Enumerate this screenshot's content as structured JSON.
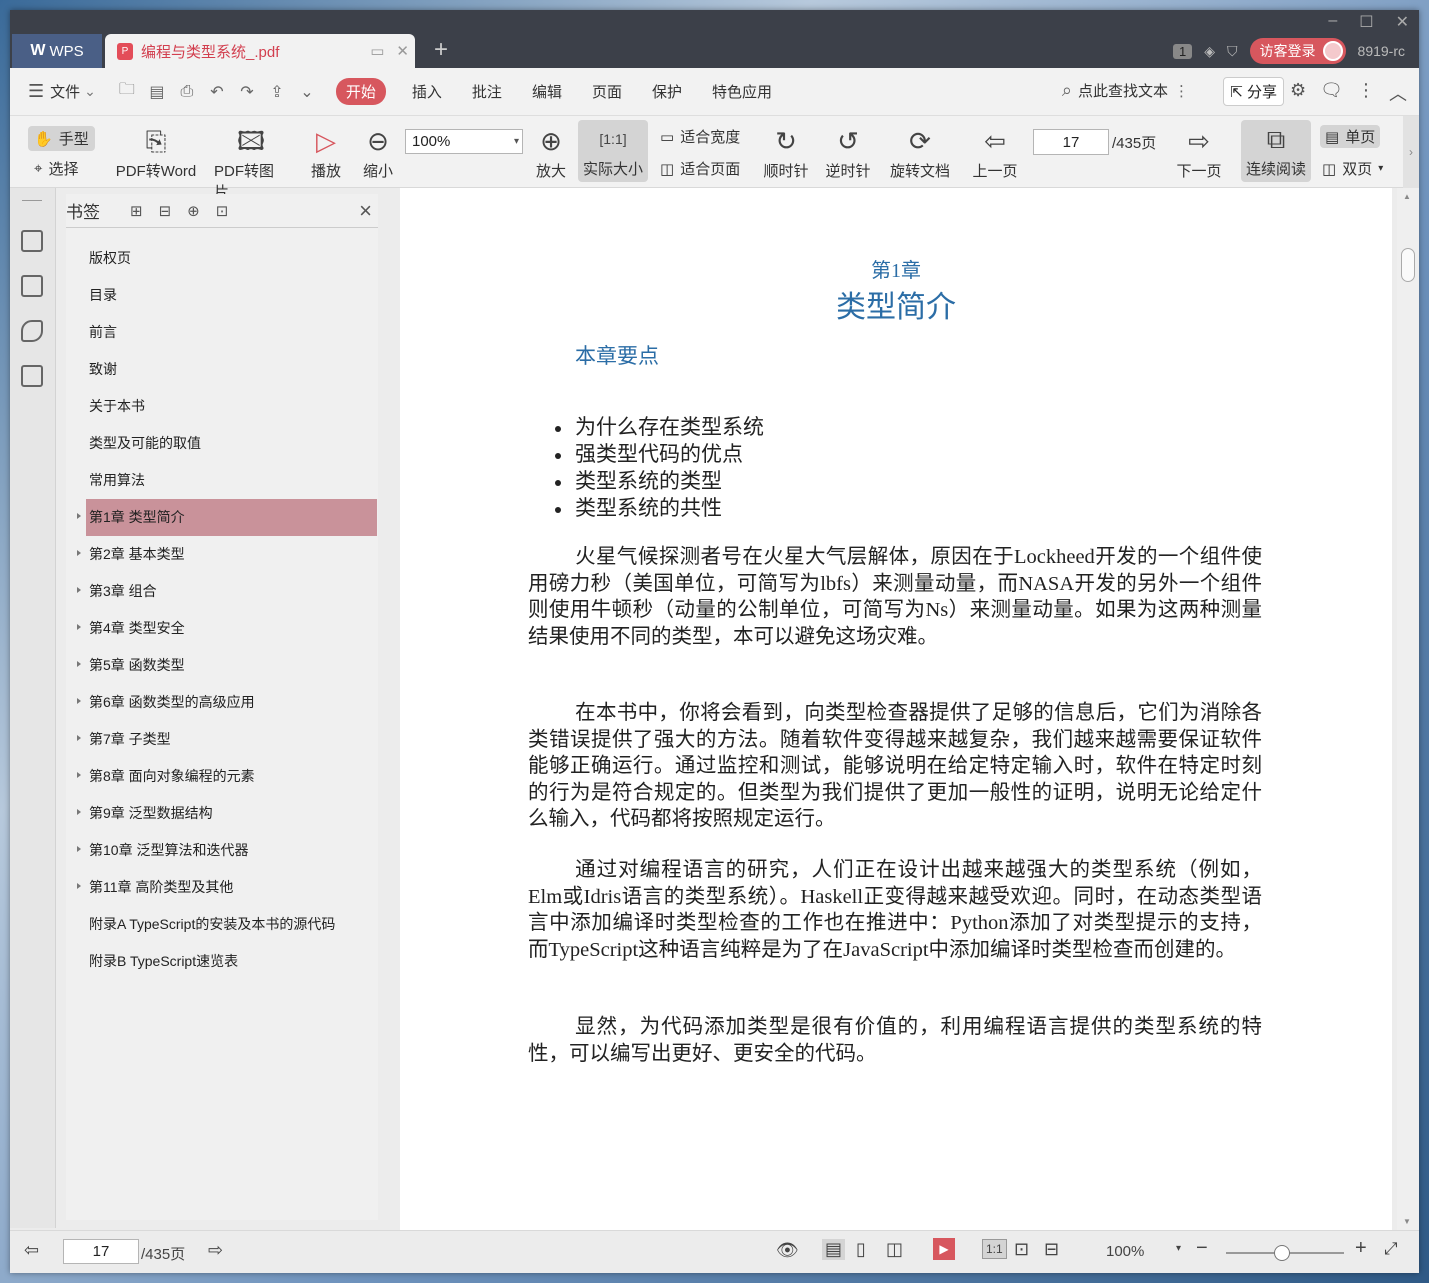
{
  "tabbar": {
    "wps_label": "WPS",
    "doc_tab_title": "编程与类型系统_.pdf",
    "badge_number": "1",
    "login_label": "访客登录",
    "user_label": "8919-rc"
  },
  "menubar": {
    "file": "文件",
    "items": [
      "开始",
      "插入",
      "批注",
      "编辑",
      "页面",
      "保护",
      "特色应用"
    ],
    "search_text": "点此查找文本",
    "share": "分享"
  },
  "toolbar": {
    "hand": "手型",
    "select": "选择",
    "pdf_word": "PDF转Word",
    "pdf_image": "PDF转图片",
    "play": "播放",
    "zoom_out": "缩小",
    "zoom_value": "100%",
    "zoom_in": "放大",
    "actual_size": "实际大小",
    "fit_width": "适合宽度",
    "fit_page": "适合页面",
    "clockwise": "顺时针",
    "counterclockwise": "逆时针",
    "rotate_doc": "旋转文档",
    "prev_page": "上一页",
    "page_number": "17",
    "page_total": "/435页",
    "next_page": "下一页",
    "continuous": "连续阅读",
    "single": "单页",
    "double": "双页"
  },
  "bookmarks": {
    "title": "书签",
    "items": [
      {
        "label": "版权页",
        "expandable": false
      },
      {
        "label": "目录",
        "expandable": false
      },
      {
        "label": "前言",
        "expandable": false
      },
      {
        "label": "致谢",
        "expandable": false
      },
      {
        "label": "关于本书",
        "expandable": false
      },
      {
        "label": "类型及可能的取值",
        "expandable": false
      },
      {
        "label": "常用算法",
        "expandable": false
      },
      {
        "label": "第1章 类型简介",
        "expandable": true,
        "active": true
      },
      {
        "label": "第2章 基本类型",
        "expandable": true
      },
      {
        "label": "第3章 组合",
        "expandable": true
      },
      {
        "label": "第4章 类型安全",
        "expandable": true
      },
      {
        "label": "第5章 函数类型",
        "expandable": true
      },
      {
        "label": "第6章 函数类型的高级应用",
        "expandable": true
      },
      {
        "label": "第7章 子类型",
        "expandable": true
      },
      {
        "label": "第8章 面向对象编程的元素",
        "expandable": true
      },
      {
        "label": "第9章 泛型数据结构",
        "expandable": true
      },
      {
        "label": "第10章 泛型算法和迭代器",
        "expandable": true
      },
      {
        "label": "第11章 高阶类型及其他",
        "expandable": true
      },
      {
        "label": "附录A TypeScript的安装及本书的源代码",
        "expandable": false
      },
      {
        "label": "附录B TypeScript速览表",
        "expandable": false
      }
    ]
  },
  "page": {
    "chapter_number": "第1章",
    "chapter_title": "类型简介",
    "key_points_heading": "本章要点",
    "bullets": [
      "为什么存在类型系统",
      "强类型代码的优点",
      "类型系统的类型",
      "类型系统的共性"
    ],
    "paragraphs": [
      "火星气候探测者号在火星大气层解体，原因在于Lockheed开发的一个组件使用磅力秒（美国单位，可简写为lbfs）来测量动量，而NASA开发的另外一个组件则使用牛顿秒（动量的公制单位，可简写为Ns）来测量动量。如果为这两种测量结果使用不同的类型，本可以避免这场灾难。",
      "在本书中，你将会看到，向类型检查器提供了足够的信息后，它们为消除各类错误提供了强大的方法。随着软件变得越来越复杂，我们越来越需要保证软件能够正确运行。通过监控和测试，能够说明在给定特定输入时，软件在特定时刻的行为是符合规定的。但类型为我们提供了更加一般性的证明，说明无论给定什么输入，代码都将按照规定运行。",
      "通过对编程语言的研究，人们正在设计出越来越强大的类型系统（例如，Elm或Idris语言的类型系统）。Haskell正变得越来越受欢迎。同时，在动态类型语言中添加编译时类型检查的工作也在推进中：Python添加了对类型提示的支持，而TypeScript这种语言纯粹是为了在JavaScript中添加编译时类型检查而创建的。",
      "显然，为代码添加类型是很有价值的，利用编程语言提供的类型系统的特性，可以编写出更好、更安全的代码。"
    ]
  },
  "statusbar": {
    "page_number": "17",
    "page_total": "/435页",
    "zoom": "100%"
  },
  "colors": {
    "accent": "#d7575e",
    "heading_blue": "#2b6da6",
    "active_bookmark": "#c9929a",
    "titlebar": "#3c4049"
  }
}
